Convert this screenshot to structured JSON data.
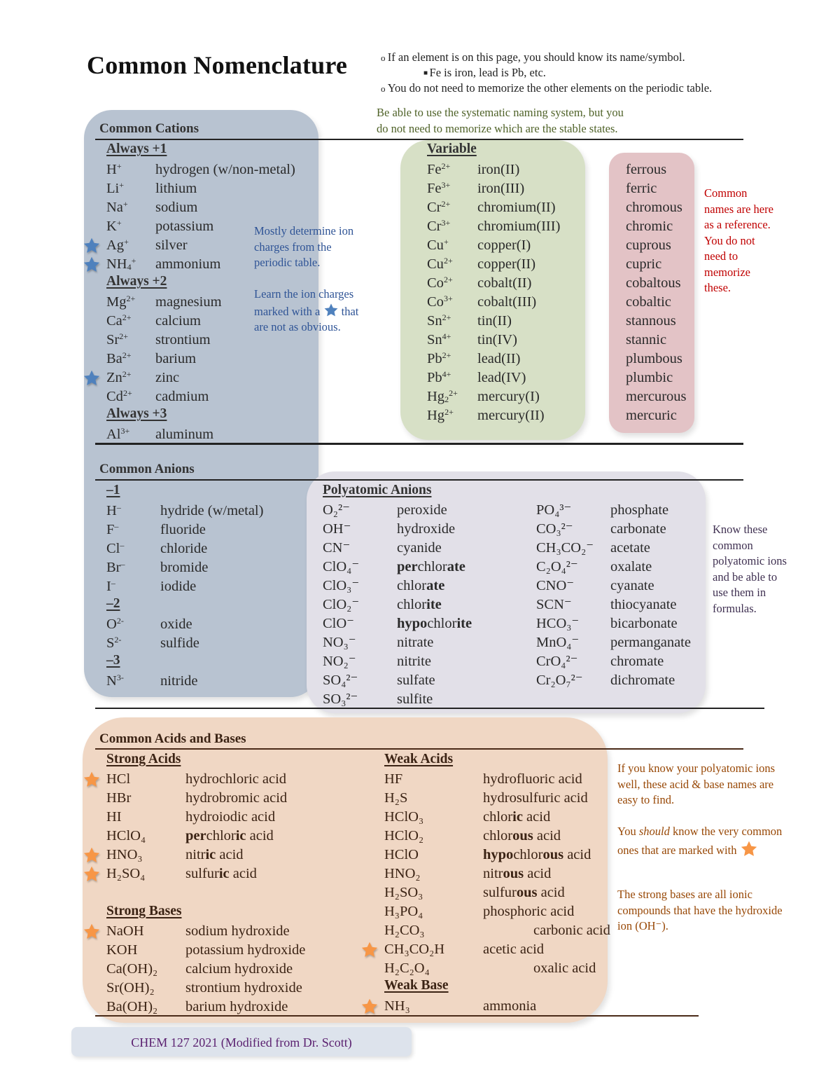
{
  "title": "Common Nomenclature",
  "intro_notes": {
    "bullet1": "If an element is on this page, you should know its name/symbol.",
    "bullet1_sub": "Fe is iron, lead is Pb, etc.",
    "bullet2": "You do not need to memorize the other elements on the periodic table.",
    "systematic_note_line1": "Be able to use the systematic naming system, but you",
    "systematic_note_line2": "do not need to memorize which are the stable states."
  },
  "colors": {
    "cation_box": "#b8c3d1",
    "variable_box": "#d7e0c6",
    "common_names_box": "#e3c3c6",
    "polyatomic_box": "#e2e0e8",
    "acids_box": "#f0d7c4",
    "blue_star": "#4f81bd",
    "orange_star": "#f79646"
  },
  "cations": {
    "title": "Common Cations",
    "groups": [
      {
        "label": "Always +1",
        "items": [
          {
            "base": "H",
            "charge": "+",
            "name": "hydrogen (w/non-metal)",
            "starred": false
          },
          {
            "base": "Li",
            "charge": "+",
            "name": "lithium",
            "starred": false
          },
          {
            "base": "Na",
            "charge": "+",
            "name": "sodium",
            "starred": false
          },
          {
            "base": "K",
            "charge": "+",
            "name": "potassium",
            "starred": false
          },
          {
            "base": "Ag",
            "charge": "+",
            "name": "silver",
            "starred": true
          },
          {
            "base": "NH",
            "subscript": "4",
            "charge": "+",
            "name": "ammonium",
            "starred": true
          }
        ]
      },
      {
        "label": "Always +2",
        "items": [
          {
            "base": "Mg",
            "charge": "2+",
            "name": "magnesium",
            "starred": false
          },
          {
            "base": "Ca",
            "charge": "2+",
            "name": "calcium",
            "starred": false
          },
          {
            "base": "Sr",
            "charge": "2+",
            "name": "strontium",
            "starred": false
          },
          {
            "base": "Ba",
            "charge": "2+",
            "name": "barium",
            "starred": false
          },
          {
            "base": "Zn",
            "charge": "2+",
            "name": "zinc",
            "starred": true
          },
          {
            "base": "Cd",
            "charge": "2+",
            "name": "cadmium",
            "starred": false
          }
        ]
      },
      {
        "label": "Always +3",
        "items": [
          {
            "base": "Al",
            "charge": "3+",
            "name": "aluminum",
            "starred": false
          }
        ]
      }
    ],
    "note1": "Mostly determine ion charges from the periodic table.",
    "note2_before": "Learn the ion charges marked with a",
    "note2_after": "that are not as obvious."
  },
  "variable": {
    "label": "Variable",
    "items": [
      {
        "base": "Fe",
        "charge": "2+",
        "name": "iron(II)",
        "common": "ferrous"
      },
      {
        "base": "Fe",
        "charge": "3+",
        "name": "iron(III)",
        "common": "ferric"
      },
      {
        "base": "Cr",
        "charge": "2+",
        "name": "chromium(II)",
        "common": "chromous"
      },
      {
        "base": "Cr",
        "charge": "3+",
        "name": "chromium(III)",
        "common": "chromic"
      },
      {
        "base": "Cu",
        "charge": "+",
        "name": "copper(I)",
        "common": "cuprous"
      },
      {
        "base": "Cu",
        "charge": "2+",
        "name": "copper(II)",
        "common": "cupric"
      },
      {
        "base": "Co",
        "charge": "2+",
        "name": "cobalt(II)",
        "common": "cobaltous"
      },
      {
        "base": "Co",
        "charge": "3+",
        "name": "cobalt(III)",
        "common": "cobaltic"
      },
      {
        "base": "Sn",
        "charge": "2+",
        "name": "tin(II)",
        "common": "stannous"
      },
      {
        "base": "Sn",
        "charge": "4+",
        "name": "tin(IV)",
        "common": "stannic"
      },
      {
        "base": "Pb",
        "charge": "2+",
        "name": "lead(II)",
        "common": "plumbous"
      },
      {
        "base": "Pb",
        "charge": "4+",
        "name": "lead(IV)",
        "common": "plumbic"
      },
      {
        "base": "Hg",
        "subscript": "2",
        "charge": "2+",
        "name": "mercury(I)",
        "common": "mercurous"
      },
      {
        "base": "Hg",
        "charge": "2+",
        "name": "mercury(II)",
        "common": "mercuric"
      }
    ],
    "common_note": "Common names are here as a reference. You do not need to memorize these."
  },
  "anions": {
    "title": "Common Anions",
    "groups": [
      {
        "label": "–1",
        "items": [
          {
            "base": "H",
            "charge": "–",
            "name": "hydride (w/metal)"
          },
          {
            "base": "F",
            "charge": "–",
            "name": "fluoride"
          },
          {
            "base": "Cl",
            "charge": "–",
            "name": "chloride"
          },
          {
            "base": "Br",
            "charge": "–",
            "name": "bromide"
          },
          {
            "base": "I",
            "charge": "–",
            "name": "iodide"
          }
        ]
      },
      {
        "label": "–2",
        "items": [
          {
            "base": "O",
            "charge": "2-",
            "name": "oxide"
          },
          {
            "base": "S",
            "charge": "2-",
            "name": "sulfide"
          }
        ]
      },
      {
        "label": "–3",
        "items": [
          {
            "base": "N",
            "charge": "3-",
            "name": "nitride"
          }
        ]
      }
    ]
  },
  "polyatomic": {
    "label": "Polyatomic Anions",
    "col1": [
      {
        "formula": "O₂²⁻",
        "name": "peroxide",
        "bold": []
      },
      {
        "formula": "OH⁻",
        "name": "hydroxide",
        "bold": []
      },
      {
        "formula": "CN⁻",
        "name": "cyanide",
        "bold": []
      },
      {
        "formula": "ClO₄⁻",
        "name_parts": [
          [
            "per",
            true
          ],
          [
            "chlor",
            false
          ],
          [
            "ate",
            true
          ]
        ]
      },
      {
        "formula": "ClO₃⁻",
        "name_parts": [
          [
            "chlor",
            false
          ],
          [
            "ate",
            true
          ]
        ]
      },
      {
        "formula": "ClO₂⁻",
        "name_parts": [
          [
            "chlor",
            false
          ],
          [
            "ite",
            true
          ]
        ]
      },
      {
        "formula": "ClO⁻",
        "name_parts": [
          [
            "hypo",
            true
          ],
          [
            "chlor",
            false
          ],
          [
            "ite",
            true
          ]
        ]
      },
      {
        "formula": "NO₃⁻",
        "name": "nitrate"
      },
      {
        "formula": "NO₂⁻",
        "name": "nitrite"
      },
      {
        "formula": "SO₄²⁻",
        "name": "sulfate"
      },
      {
        "formula": "SO₃²⁻",
        "name": "sulfite"
      }
    ],
    "col2": [
      {
        "formula": "PO₄³⁻",
        "name": "phosphate"
      },
      {
        "formula": "CO₃²⁻",
        "name": "carbonate"
      },
      {
        "formula": "CH₃CO₂⁻",
        "name": "acetate"
      },
      {
        "formula": "C₂O₄²⁻",
        "name": "oxalate"
      },
      {
        "formula": "CNO⁻",
        "name": "cyanate"
      },
      {
        "formula": "SCN⁻",
        "name": "thiocyanate"
      },
      {
        "formula": "HCO₃⁻",
        "name": "bicarbonate"
      },
      {
        "formula": "MnO₄⁻",
        "name": "permanganate"
      },
      {
        "formula": "CrO₄²⁻",
        "name": "chromate"
      },
      {
        "formula": "Cr₂O₇²⁻",
        "name": "dichromate"
      }
    ],
    "note": "Know these common polyatomic ions and be able to use them in formulas."
  },
  "acids_bases": {
    "title": "Common Acids and Bases",
    "strong_acids": {
      "label": "Strong Acids",
      "items": [
        {
          "formula": "HCl",
          "name_parts": [
            [
              "hydrochloric acid",
              false
            ]
          ],
          "starred": true
        },
        {
          "formula": "HBr",
          "name_parts": [
            [
              "hydrobromic acid",
              false
            ]
          ],
          "starred": false
        },
        {
          "formula": "HI",
          "name_parts": [
            [
              "hydroiodic acid",
              false
            ]
          ],
          "starred": false
        },
        {
          "formula": "HClO₄",
          "name_parts": [
            [
              "per",
              true
            ],
            [
              "chlor",
              false
            ],
            [
              "ic",
              true
            ],
            [
              " acid",
              false
            ]
          ],
          "starred": false
        },
        {
          "formula": "HNO₃",
          "name_parts": [
            [
              "nitr",
              false
            ],
            [
              "ic",
              true
            ],
            [
              " acid",
              false
            ]
          ],
          "starred": true
        },
        {
          "formula": "H₂SO₄",
          "name_parts": [
            [
              "sulfur",
              false
            ],
            [
              "ic",
              true
            ],
            [
              " acid",
              false
            ]
          ],
          "starred": true
        }
      ]
    },
    "strong_bases": {
      "label": "Strong Bases",
      "items": [
        {
          "formula": "NaOH",
          "name": "sodium hydroxide",
          "starred": true
        },
        {
          "formula": "KOH",
          "name": "potassium hydroxide",
          "starred": false
        },
        {
          "formula": "Ca(OH)₂",
          "name": "calcium hydroxide",
          "starred": false
        },
        {
          "formula": "Sr(OH)₂",
          "name": "strontium hydroxide",
          "starred": false
        },
        {
          "formula": "Ba(OH)₂",
          "name": "barium hydroxide",
          "starred": false
        }
      ]
    },
    "weak_acids": {
      "label": "Weak Acids",
      "items": [
        {
          "formula": "HF",
          "name_parts": [
            [
              "hydrofluoric acid",
              false
            ]
          ],
          "starred": false
        },
        {
          "formula": "H₂S",
          "name_parts": [
            [
              "hydrosulfuric acid",
              false
            ]
          ],
          "starred": false
        },
        {
          "formula": "HClO₃",
          "name_parts": [
            [
              "chlor",
              false
            ],
            [
              "ic",
              true
            ],
            [
              " acid",
              false
            ]
          ],
          "starred": false
        },
        {
          "formula": "HClO₂",
          "name_parts": [
            [
              "chlor",
              false
            ],
            [
              "ous",
              true
            ],
            [
              " acid",
              false
            ]
          ],
          "starred": false
        },
        {
          "formula": "HClO",
          "name_parts": [
            [
              "hypo",
              true
            ],
            [
              "chlor",
              false
            ],
            [
              "ous",
              true
            ],
            [
              " acid",
              false
            ]
          ],
          "starred": false
        },
        {
          "formula": "HNO₂",
          "name_parts": [
            [
              "nitr",
              false
            ],
            [
              "ous",
              true
            ],
            [
              " acid",
              false
            ]
          ],
          "starred": false
        },
        {
          "formula": "H₂SO₃",
          "name_parts": [
            [
              "sulfur",
              false
            ],
            [
              "ous",
              true
            ],
            [
              " acid",
              false
            ]
          ],
          "starred": false
        },
        {
          "formula": "H₃PO₄",
          "name_parts": [
            [
              "phosphoric acid",
              false
            ]
          ],
          "starred": false
        },
        {
          "formula": "H₂CO₃",
          "name_parts": [
            [
              "carbonic acid",
              false
            ]
          ],
          "starred": false,
          "indented": true
        },
        {
          "formula": "CH₃CO₂H",
          "name_parts": [
            [
              "acetic acid",
              false
            ]
          ],
          "starred": true
        },
        {
          "formula": "H₂C₂O₄",
          "name_parts": [
            [
              "oxalic acid",
              false
            ]
          ],
          "starred": false,
          "indented": true
        }
      ]
    },
    "weak_base": {
      "label": "Weak Base",
      "items": [
        {
          "formula": "NH₃",
          "name": "ammonia",
          "starred": true
        }
      ]
    },
    "note1": "If you know your polyatomic ions well, these acid & base names are easy to find.",
    "note2_before": "You",
    "note2_em": "should",
    "note2_after": "know the very common ones that are marked with",
    "note3": "The strong bases are all ionic compounds that have the hydroxide ion (OH⁻)."
  },
  "footer": "CHEM 127 2021 (Modified from Dr. Scott)"
}
